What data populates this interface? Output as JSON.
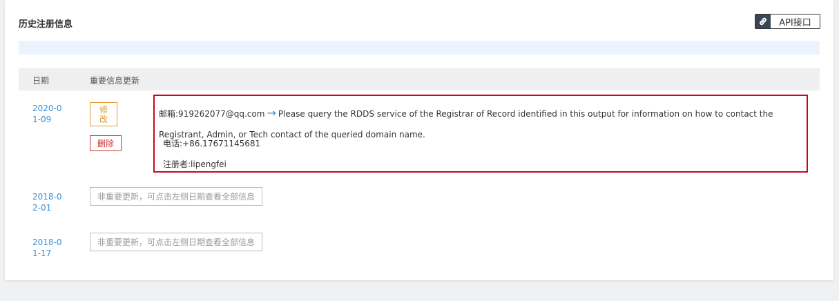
{
  "section_title": "历史注册信息",
  "api_button": {
    "label": "API接口",
    "icon": "link-icon"
  },
  "table": {
    "headers": [
      "日期",
      "重要信息更新"
    ]
  },
  "records": [
    {
      "date_line1": "2020-0",
      "date_line2": "1-09",
      "edit_label": "修改",
      "delete_label": "删除",
      "email_label": "邮箱:",
      "email_value": "919262077@qq.com",
      "email_new": "Please query the RDDS service of the Registrar of Record identified in this output for information on how to contact the Registrant, Admin, or Tech contact of the queried domain name.",
      "phone": "电话:+86.17671145681",
      "registrant": "注册者:lipengfei"
    },
    {
      "date_line1": "2018-0",
      "date_line2": "2-01",
      "note": "非重要更新，可点击左侧日期查看全部信息"
    },
    {
      "date_line1": "2018-0",
      "date_line2": "1-17",
      "note": "非重要更新，可点击左侧日期查看全部信息"
    }
  ],
  "colors": {
    "accent": "#3b8fd6",
    "highlight_border": "#d0021b",
    "edit": "#e09a2c",
    "delete": "#c9302c"
  }
}
